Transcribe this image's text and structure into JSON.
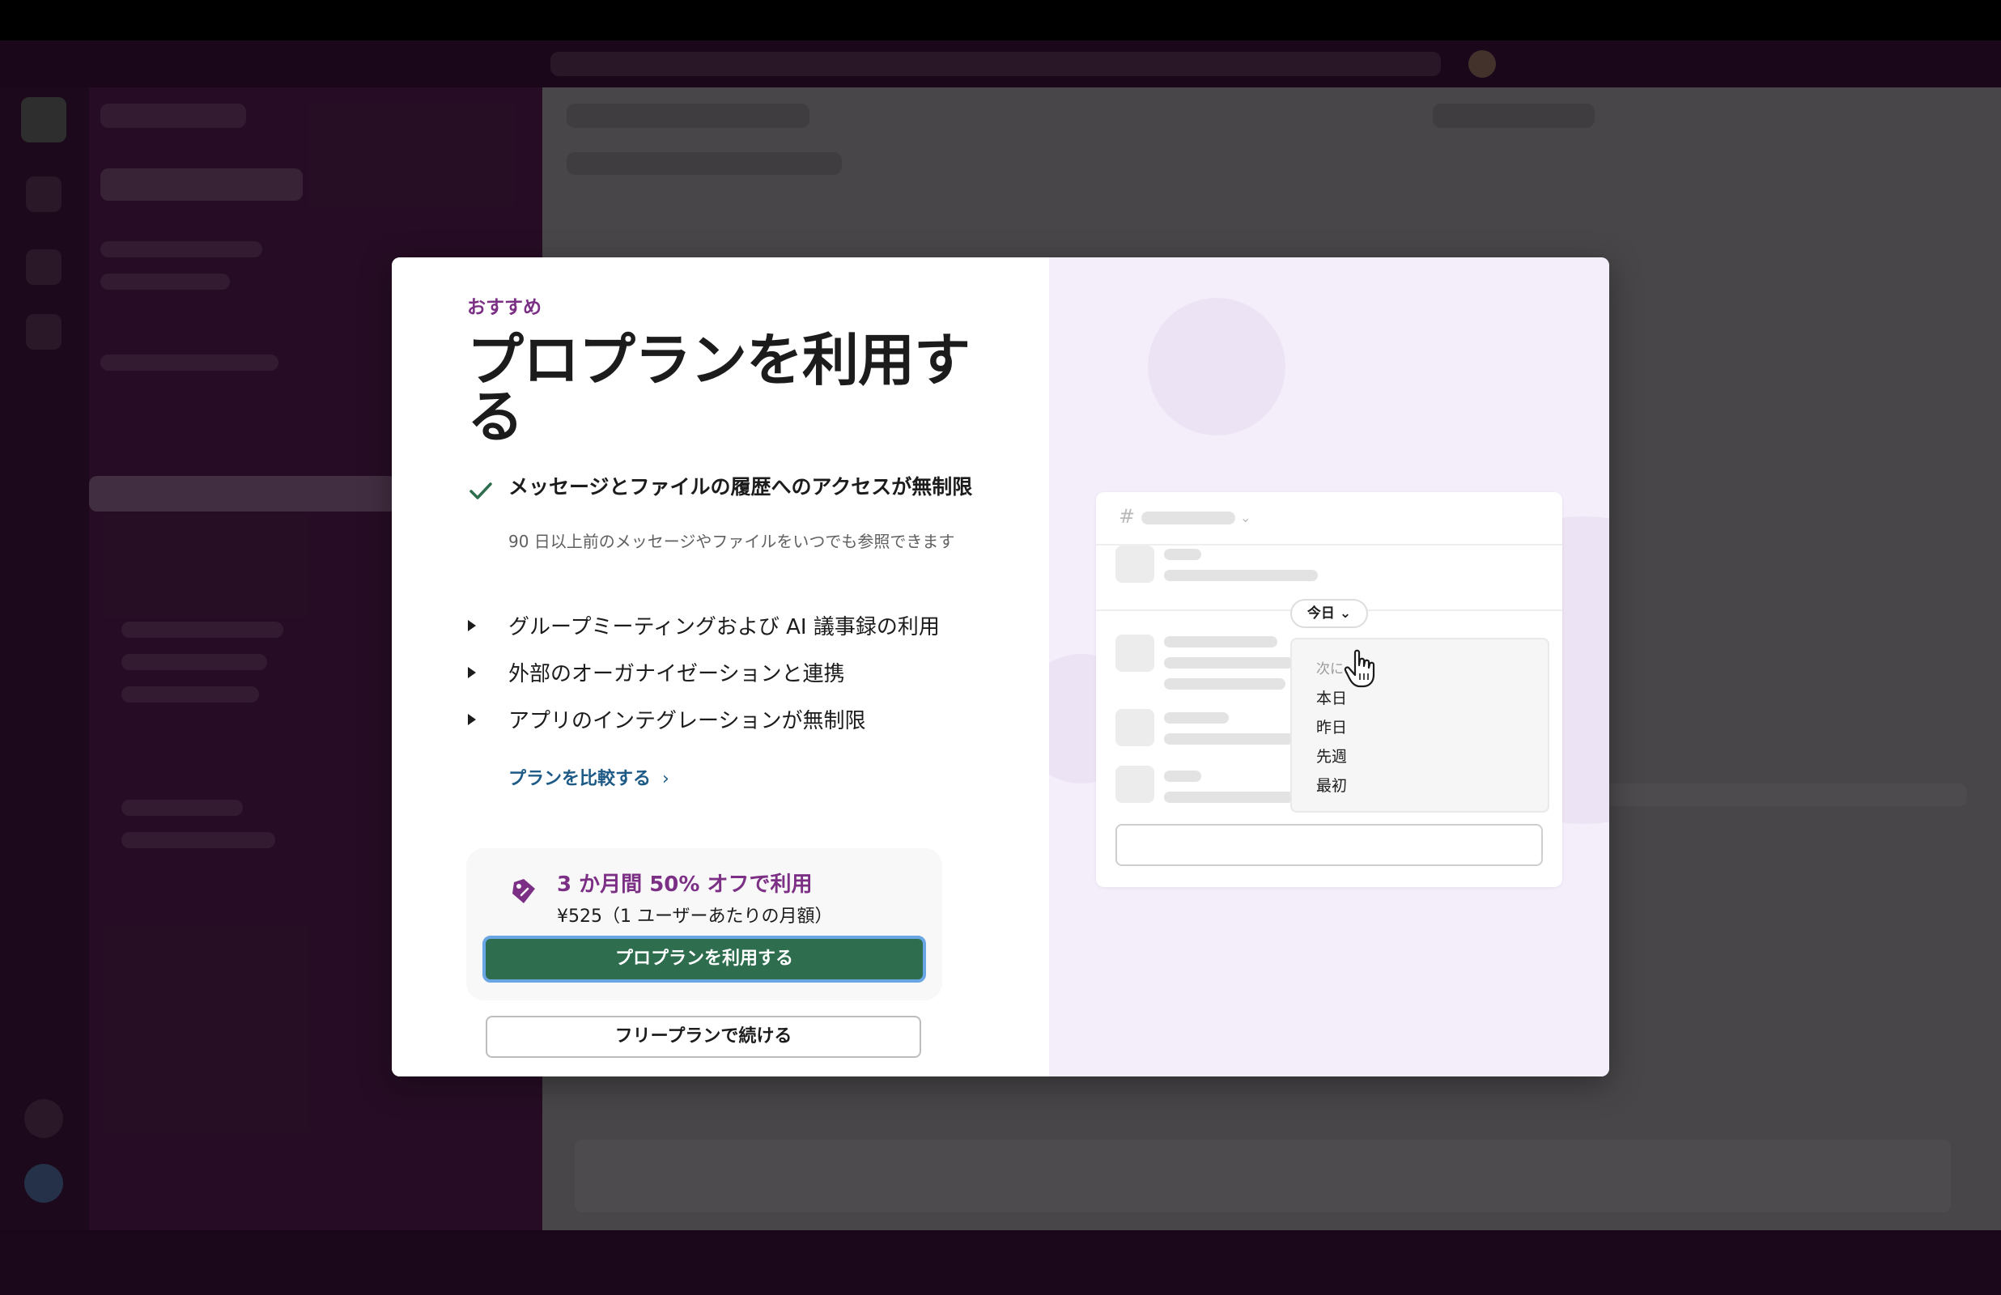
{
  "modal": {
    "eyebrow": "おすすめ",
    "title": "プロプランを利用する",
    "features": {
      "main_title": "メッセージとファイルの履歴へのアクセスが無制限",
      "main_desc": "90 日以上前のメッセージやファイルをいつでも参照できます",
      "bullets": [
        "グループミーティングおよび AI 議事録の利用",
        "外部のオーガナイゼーションと連携",
        "アプリのインテグレーションが無制限"
      ]
    },
    "compare_link": "プランを比較する",
    "offer": {
      "title": "3 か月間 50% オフで利用",
      "price": "¥525（1 ユーザーあたりの月額）",
      "primary_button": "プロプランを利用する"
    },
    "secondary_button": "フリープランで続ける"
  },
  "illustration": {
    "today_label": "今日",
    "menu_heading": "次に…",
    "menu_items": [
      "本日",
      "昨日",
      "先週",
      "最初"
    ]
  },
  "colors": {
    "accent_purple": "#7c3085",
    "primary_green": "#2e6e4f",
    "link_blue": "#1d5a86",
    "right_pane": "#f4eefb"
  }
}
